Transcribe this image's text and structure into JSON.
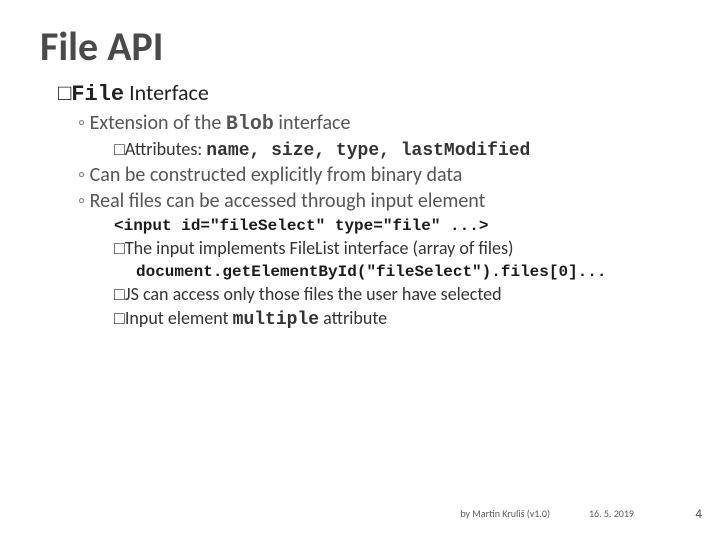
{
  "title": "File API",
  "l1": {
    "box": "□",
    "codeWord": "File",
    "rest": " Interface"
  },
  "l2a": {
    "pre": "Extension of the ",
    "code": "Blob",
    "post": " interface"
  },
  "l3a": {
    "box": "□",
    "lead": "Attributes: ",
    "attrs": "name, size, type, lastModified"
  },
  "l2b": "Can be constructed explicitly from binary data",
  "l2c": "Real files can be accessed through input element",
  "code1": "<input id=\"fileSelect\" type=\"file\" ...>",
  "l3b": {
    "box": "□",
    "text": "The input implements FileList interface (array of files)"
  },
  "code2": "document.getElementById(\"fileSelect\").files[0]...",
  "l3c": {
    "box": "□",
    "text": "JS can access only those files the user have selected"
  },
  "l3d": {
    "box": "□",
    "pre": "Input element ",
    "code": "multiple",
    "post": " attribute"
  },
  "footer": {
    "by": "by Martin Kruliš (v1.0)",
    "date": "16. 5. 2019",
    "page": "4"
  }
}
